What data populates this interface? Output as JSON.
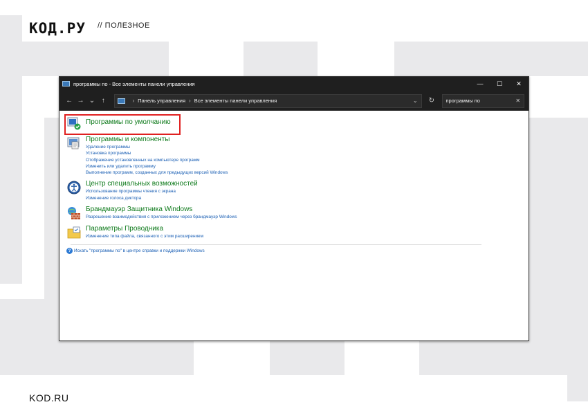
{
  "page": {
    "brand": "КОД.РУ",
    "section": "// ПОЛЕЗНОЕ",
    "footer_brand": "KOD.RU"
  },
  "window": {
    "title": "программы по - Все элементы панели управления",
    "controls": {
      "minimize": "—",
      "maximize": "☐",
      "close": "✕"
    },
    "nav": {
      "back": "←",
      "forward": "→",
      "recent": "⌄",
      "up": "↑"
    },
    "address": {
      "crumbs": [
        "Панель управления",
        "Все элементы панели управления"
      ],
      "separator": "›",
      "dropdown": "⌄",
      "refresh": "↻"
    },
    "search": {
      "value": "программы по",
      "clear": "✕"
    },
    "categories": [
      {
        "title": "Программы по умолчанию",
        "icon": "default-programs-icon",
        "links": []
      },
      {
        "title": "Программы и компоненты",
        "icon": "programs-features-icon",
        "links": [
          "Удаление программы",
          "Установка программы",
          "Отображение установленных на компьютере программ",
          "Изменить или удалить программу",
          "Выполнение программ, созданных для предыдущих версий Windows"
        ]
      },
      {
        "title": "Центр специальных возможностей",
        "icon": "ease-of-access-icon",
        "links": [
          "Использование программы чтения с экрана",
          "Изменение голоса диктора"
        ]
      },
      {
        "title": "Брандмауэр Защитника Windows",
        "icon": "firewall-icon",
        "links": [
          "Разрешение взаимодействия с приложением через брандмауэр Windows"
        ]
      },
      {
        "title": "Параметры Проводника",
        "icon": "explorer-options-icon",
        "links": [
          "Изменение типа файла, связанного с этим расширением"
        ]
      }
    ],
    "help_link": "Искать \"программы по\" в центре справки и поддержки Windows",
    "colors": {
      "accent_green": "#0e7a1b",
      "link_blue": "#1a5fb4",
      "highlight_red": "#e02020",
      "titlebar": "#1f1f1f"
    }
  }
}
